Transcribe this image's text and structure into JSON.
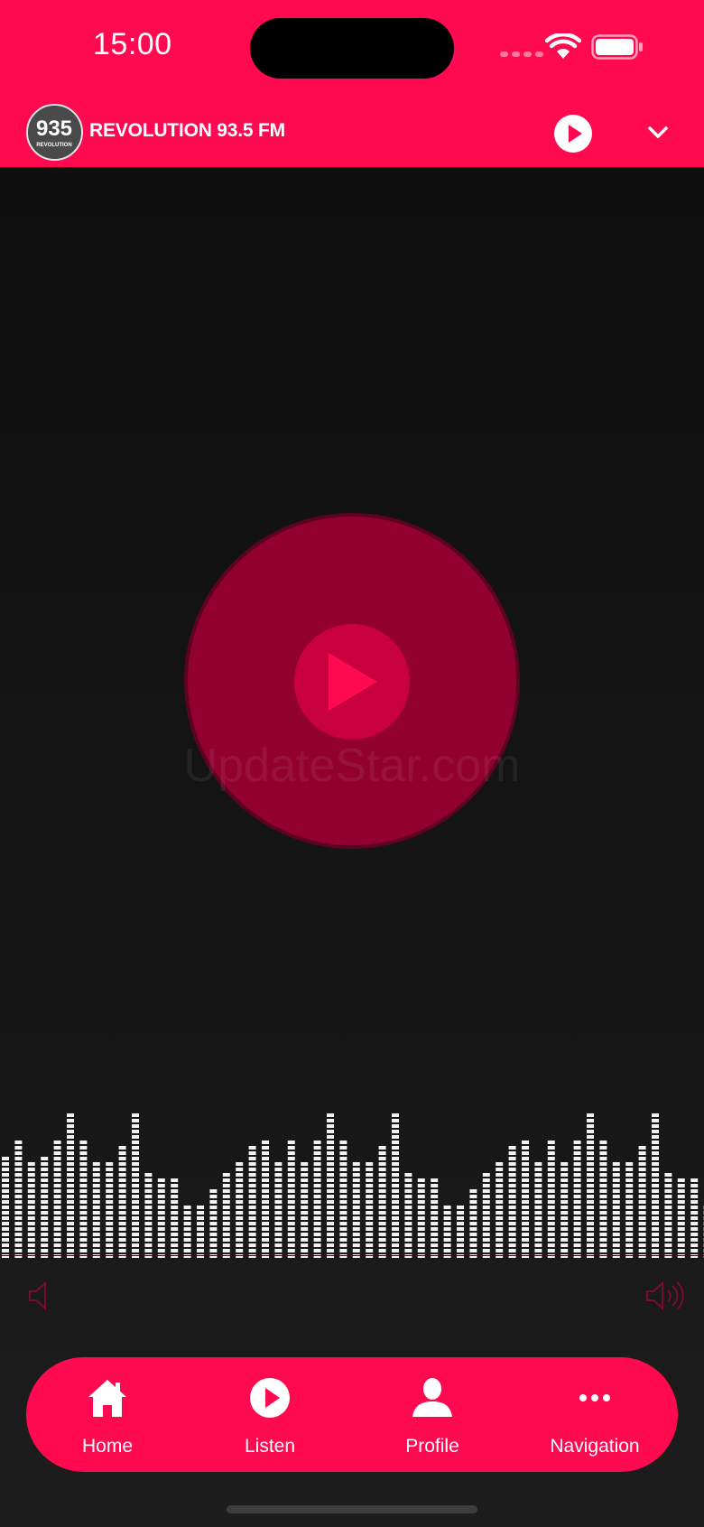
{
  "status_bar": {
    "time": "15:00",
    "icons": [
      "cellular-signal-icon",
      "wifi-icon",
      "battery-icon"
    ]
  },
  "header": {
    "logo_text": "935",
    "logo_subtext": "REVOLUTION",
    "station_name": "REVOLUTION 93.5 FM",
    "play_icon": "play-circle-icon",
    "collapse_icon": "chevron-down-icon"
  },
  "player": {
    "play_icon": "play-icon",
    "watermark": "UpdateStar.com",
    "volume_low_icon": "speaker-low-icon",
    "volume_high_icon": "speaker-high-icon",
    "visualizer_levels": [
      0.65,
      0.75,
      0.6,
      0.65,
      0.75,
      0.9,
      0.75,
      0.6,
      0.6,
      0.7,
      0.9,
      0.55,
      0.5,
      0.5,
      0.35,
      0.35,
      0.45,
      0.55,
      0.6,
      0.7,
      0.75,
      0.6,
      0.75,
      0.6,
      0.75,
      0.9,
      0.75,
      0.6,
      0.6,
      0.7,
      0.9,
      0.55,
      0.5,
      0.5,
      0.35,
      0.35,
      0.45,
      0.55,
      0.6,
      0.7,
      0.75,
      0.6,
      0.75,
      0.6,
      0.75,
      0.9,
      0.75,
      0.6,
      0.6,
      0.7,
      0.9,
      0.55,
      0.5,
      0.5,
      0.35
    ]
  },
  "bottom_nav": {
    "items": [
      {
        "label": "Home",
        "icon": "home-icon"
      },
      {
        "label": "Listen",
        "icon": "play-circle-icon"
      },
      {
        "label": "Profile",
        "icon": "user-icon"
      },
      {
        "label": "Navigation",
        "icon": "more-dots-icon"
      }
    ]
  },
  "colors": {
    "accent": "#FF0A50",
    "disc": "#92002F",
    "disc_inner": "#C9003F",
    "background": "#121212"
  }
}
